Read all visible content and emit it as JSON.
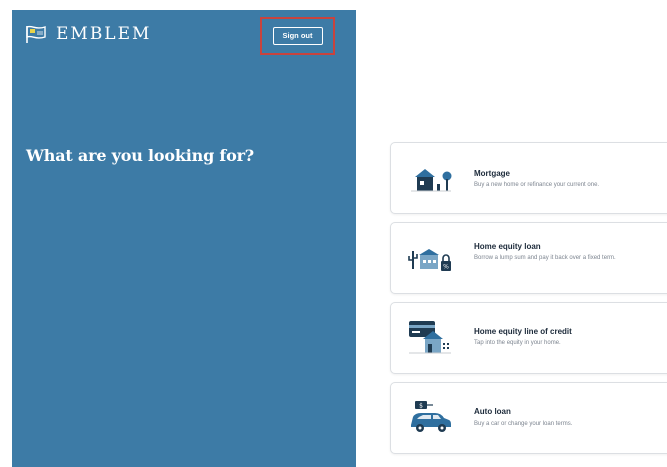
{
  "header": {
    "brand": "EMBLEM",
    "sign_out_label": "Sign out"
  },
  "main": {
    "headline": "What are you looking for?"
  },
  "options": [
    {
      "title": "Mortgage",
      "description": "Buy a new home or refinance your current one.",
      "icon": "house-tree-icon"
    },
    {
      "title": "Home equity loan",
      "description": "Borrow a lump sum and pay it back over a fixed term.",
      "icon": "house-lock-icon"
    },
    {
      "title": "Home equity line of credit",
      "description": "Tap into the equity in your home.",
      "icon": "card-house-icon"
    },
    {
      "title": "Auto loan",
      "description": "Buy a car or change your loan terms.",
      "icon": "car-icon"
    }
  ],
  "colors": {
    "panel_blue": "#3d7ba6",
    "highlight_red": "#c9433e",
    "icon_dark": "#1f3b52",
    "icon_blue": "#2f6f9f"
  }
}
